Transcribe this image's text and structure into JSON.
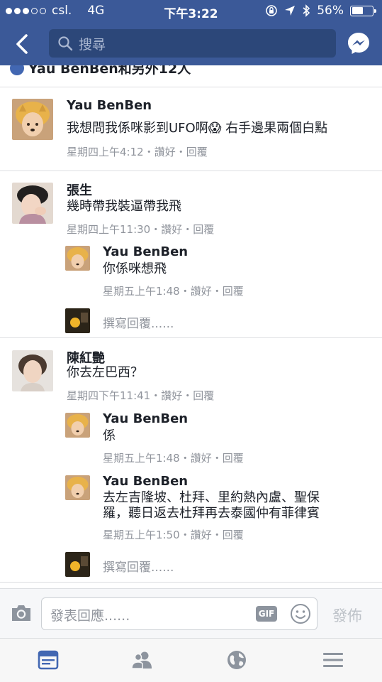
{
  "status_bar": {
    "carrier": "csl.",
    "network": "4G",
    "time": "下午3:22",
    "battery_percent": "56%",
    "battery_level": 0.56
  },
  "nav": {
    "search_placeholder": "搜尋"
  },
  "likes_banner": "Yau BenBen和另外12人",
  "comments": [
    {
      "author": "Yau BenBen",
      "text": "我想問我係咪影到UFO啊😱 右手邊果兩個白點",
      "time": "星期四上午4:12",
      "like": "讚好",
      "reply": "回覆"
    },
    {
      "author": "張生",
      "text": "幾時帶我裝逼帶我飛",
      "time": "星期四上午11:30",
      "like": "讚好",
      "reply": "回覆",
      "replies": [
        {
          "author": "Yau BenBen",
          "text": "你係咪想飛",
          "time": "星期五上午1:48",
          "like": "讚好",
          "reply": "回覆"
        }
      ],
      "reply_placeholder": "撰寫回覆......"
    },
    {
      "author": "陳紅艷",
      "text": "你去左巴西？",
      "time": "星期四下午11:41",
      "like": "讚好",
      "reply": "回覆",
      "replies": [
        {
          "author": "Yau BenBen",
          "text": "係",
          "time": "星期五上午1:48",
          "like": "讚好",
          "reply": "回覆"
        },
        {
          "author": "Yau BenBen",
          "text_line1": "去左吉隆坡、杜拜、里約熱內盧、聖保",
          "text_line2": "羅，聽日返去杜拜再去泰國仲有菲律賓",
          "time": "星期五上午1:50",
          "like": "讚好",
          "reply": "回覆"
        }
      ],
      "reply_placeholder": "撰寫回覆......"
    }
  ],
  "meta_separator": "・",
  "compose": {
    "placeholder": "發表回應......",
    "gif_label": "GIF",
    "send_label": "發佈"
  },
  "icons": {
    "tab_news_feed": "news-feed-icon",
    "tab_friends": "friends-icon",
    "tab_notifications": "globe-icon",
    "tab_menu": "menu-icon"
  },
  "colors": {
    "brand": "#3b5998",
    "active_tab": "#4267b2",
    "meta_text": "#90949c"
  }
}
